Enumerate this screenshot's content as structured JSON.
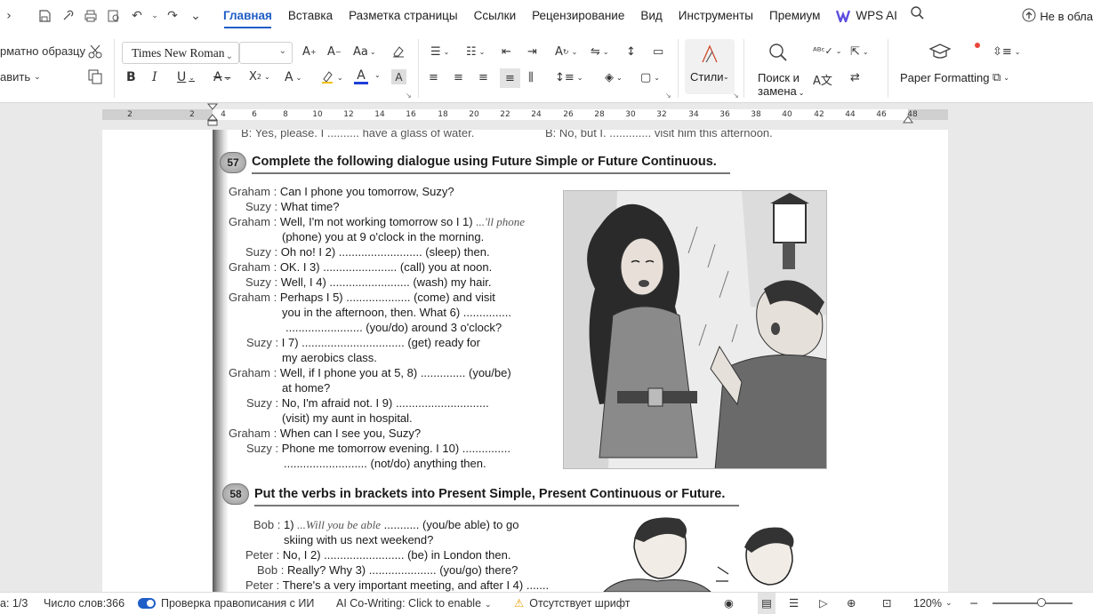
{
  "menubar": {
    "tabs": [
      "Главная",
      "Вставка",
      "Разметка страницы",
      "Ссылки",
      "Рецензирование",
      "Вид",
      "Инструменты",
      "Премиум"
    ],
    "active_tab": "Главная",
    "wps_ai": "WPS AI",
    "cloud": "Не в обла"
  },
  "ribbon": {
    "format_painter": "рматно образцу",
    "paste": "авить",
    "font_name": "Times New Roman",
    "font_size": "",
    "styles_label": "Стили",
    "find_replace_line1": "Поиск и",
    "find_replace_line2": "замена",
    "paper_formatting": "Paper Formatting"
  },
  "ruler": {
    "ticks": [
      "2",
      "2",
      "4",
      "6",
      "8",
      "10",
      "12",
      "14",
      "16",
      "18",
      "20",
      "22",
      "24",
      "26",
      "28",
      "30",
      "32",
      "34",
      "36",
      "38",
      "40",
      "42",
      "44",
      "46",
      "48"
    ]
  },
  "document": {
    "top_line_left": "B: Yes, please. I .......... have a glass of water.",
    "top_line_right": "B: No, but I. ............. visit him this afternoon.",
    "ex57": {
      "number": "57",
      "title": "Complete the following dialogue using Future Simple or Future Continuous.",
      "lines": [
        {
          "speaker": "Graham :",
          "text": "Can I phone you tomorrow, Suzy?"
        },
        {
          "speaker": "Suzy :",
          "text": "What time?"
        },
        {
          "speaker": "Graham :",
          "text": "Well, I'm not working tomorrow so I 1)",
          "answer": "...'ll phone"
        },
        {
          "speaker": "",
          "text": "(phone) you at 9 o'clock in the morning."
        },
        {
          "speaker": "Suzy :",
          "text": "Oh no! I 2) .......................... (sleep) then."
        },
        {
          "speaker": "Graham :",
          "text": "OK. I 3) ....................... (call) you at noon."
        },
        {
          "speaker": "Suzy :",
          "text": "Well, I 4) ......................... (wash) my hair."
        },
        {
          "speaker": "Graham :",
          "text": "Perhaps I 5) .................... (come) and visit"
        },
        {
          "speaker": "",
          "text": "you in the afternoon, then. What 6) ..............."
        },
        {
          "speaker": "",
          "text": "........................ (you/do) around 3 o'clock?"
        },
        {
          "speaker": "Suzy :",
          "text": "I 7) ................................ (get) ready for"
        },
        {
          "speaker": "",
          "text": "my aerobics class."
        },
        {
          "speaker": "Graham :",
          "text": "Well, if I phone you at 5, 8) .............. (you/be)"
        },
        {
          "speaker": "",
          "text": "at home?"
        },
        {
          "speaker": "Suzy :",
          "text": "No, I'm afraid not. I 9) ............................."
        },
        {
          "speaker": "",
          "text": "(visit) my aunt in hospital."
        },
        {
          "speaker": "Graham :",
          "text": "When can I see you, Suzy?"
        },
        {
          "speaker": "Suzy :",
          "text": "Phone me tomorrow evening. I 10) ..............."
        },
        {
          "speaker": "",
          "text": ".......................... (not/do) anything then."
        }
      ]
    },
    "ex58": {
      "number": "58",
      "title": "Put the verbs in brackets into Present Simple, Present Continuous or Future.",
      "lines": [
        {
          "speaker": "Bob :",
          "text": "1)",
          "answer": "...Will you be able",
          "rest": "........... (you/be able) to go"
        },
        {
          "speaker": "",
          "text": "skiing with us next weekend?"
        },
        {
          "speaker": "Peter :",
          "text": "No, I 2) ......................... (be) in London then."
        },
        {
          "speaker": "Bob :",
          "text": "Really? Why 3) ..................... (you/go) there?"
        },
        {
          "speaker": "Peter :",
          "text": "There's a very important meeting, and after I 4) ......."
        }
      ]
    }
  },
  "statusbar": {
    "page": "а: 1/3",
    "word_count": "Число слов:366",
    "spellcheck": "Проверка правописания с ИИ",
    "ai_cowriting": "AI Co-Writing: Click to enable",
    "missing_font": "Отсутствует шрифт",
    "zoom": "120%"
  }
}
